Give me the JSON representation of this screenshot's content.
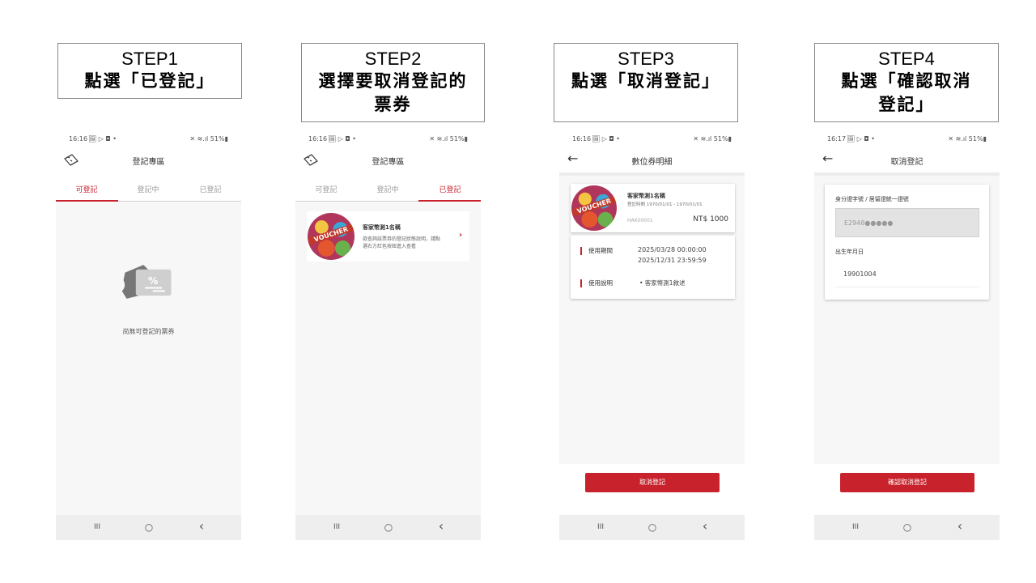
{
  "steps": [
    {
      "title": "STEP1",
      "desc_lines": [
        "點選「已登記」"
      ]
    },
    {
      "title": "STEP2",
      "desc_lines": [
        "選擇要取消登記的",
        "票券"
      ]
    },
    {
      "title": "STEP3",
      "desc_lines": [
        "點選「取消登記」"
      ]
    },
    {
      "title": "STEP4",
      "desc_lines": [
        "點選「確認取消",
        "登記」"
      ]
    }
  ],
  "phone1": {
    "time": "16:16",
    "status_icons": "🖼 ▷ ◘ •",
    "battery": "✕ ≋.ıl 51%▮",
    "title": "登記專區",
    "tabs": [
      "可登記",
      "登記中",
      "已登記"
    ],
    "empty_text": "尚無可登記的票券"
  },
  "phone2": {
    "time": "16:16",
    "status_icons": "🖼 ▷ ◘ •",
    "battery": "✕ ≋.ıl 51%▮",
    "title": "登記專區",
    "tabs": [
      "可登記",
      "登記中",
      "已登記"
    ],
    "ticket": {
      "voucher_label": "VOUCHER",
      "name": "客家幣測1名稱",
      "desc_1": "欲查詢該票券的登記狀態說明，請點",
      "desc_2": "選右方紅色按鈕進入查看"
    }
  },
  "phone3": {
    "time": "16:16",
    "status_icons": "🖼 ▷ ◘ •",
    "battery": "✕ ≋.ıl 51%▮",
    "title": "數位券明細",
    "ticket": {
      "voucher_label": "VOUCHER",
      "name": "客家幣測1名稱",
      "period": "登記時間 1970/01/01 - 1970/01/01",
      "code": "HAK00001",
      "price": "NT$  1000"
    },
    "usage_period_label": "使用期間",
    "usage_start": "2025/03/28 00:00:00",
    "usage_end": "2025/12/31 23:59:59",
    "usage_desc_label": "使用說明",
    "usage_desc": "• 客家幣測1敘述",
    "button": "取消登記"
  },
  "phone4": {
    "time": "16:17",
    "status_icons": "🖼 ▷ ◘ •",
    "battery": "✕ ≋.ıl 51%▮",
    "title": "取消登記",
    "id_label": "身分證字號 / 居留證統一證號",
    "id_value": "E2948●●●●●",
    "birth_label": "出生年月日",
    "birth_value": "19901004",
    "button": "確認取消登記"
  },
  "nav": {
    "recent": "III",
    "home": "○",
    "back": "‹"
  },
  "colors": {
    "accent": "#c8232c",
    "navbar": "#eeeeee",
    "content_bg": "#f7f7f7"
  }
}
